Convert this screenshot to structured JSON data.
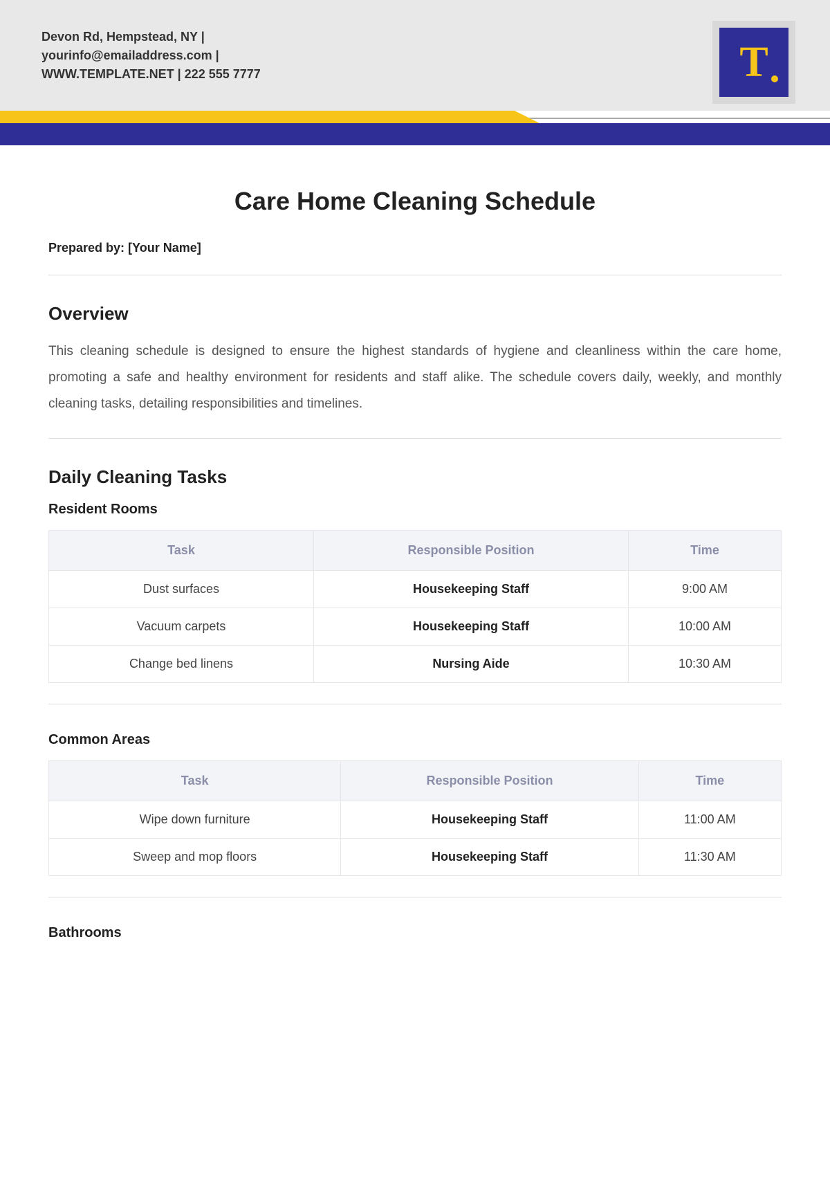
{
  "header": {
    "contact_line1": "Devon Rd, Hempstead, NY |",
    "contact_line2": "yourinfo@emailaddress.com |",
    "contact_line3": "WWW.TEMPLATE.NET | 222 555 7777",
    "logo_letter": "T"
  },
  "title": "Care Home Cleaning Schedule",
  "prepared_by": "Prepared by: [Your Name]",
  "overview": {
    "heading": "Overview",
    "text": "This cleaning schedule is designed to ensure the highest standards of hygiene and cleanliness within the care home, promoting a safe and healthy environment for residents and staff alike. The schedule covers daily, weekly, and monthly cleaning tasks, detailing responsibilities and timelines."
  },
  "daily": {
    "heading": "Daily Cleaning Tasks",
    "columns": {
      "task": "Task",
      "resp": "Responsible Position",
      "time": "Time"
    },
    "sections": [
      {
        "title": "Resident Rooms",
        "rows": [
          {
            "task": "Dust surfaces",
            "resp": "Housekeeping Staff",
            "time": "9:00 AM"
          },
          {
            "task": "Vacuum carpets",
            "resp": "Housekeeping Staff",
            "time": "10:00 AM"
          },
          {
            "task": "Change bed linens",
            "resp": "Nursing Aide",
            "time": "10:30 AM"
          }
        ]
      },
      {
        "title": "Common Areas",
        "rows": [
          {
            "task": "Wipe down furniture",
            "resp": "Housekeeping Staff",
            "time": "11:00 AM"
          },
          {
            "task": "Sweep and mop floors",
            "resp": "Housekeeping Staff",
            "time": "11:30 AM"
          }
        ]
      },
      {
        "title": "Bathrooms",
        "rows": []
      }
    ]
  }
}
